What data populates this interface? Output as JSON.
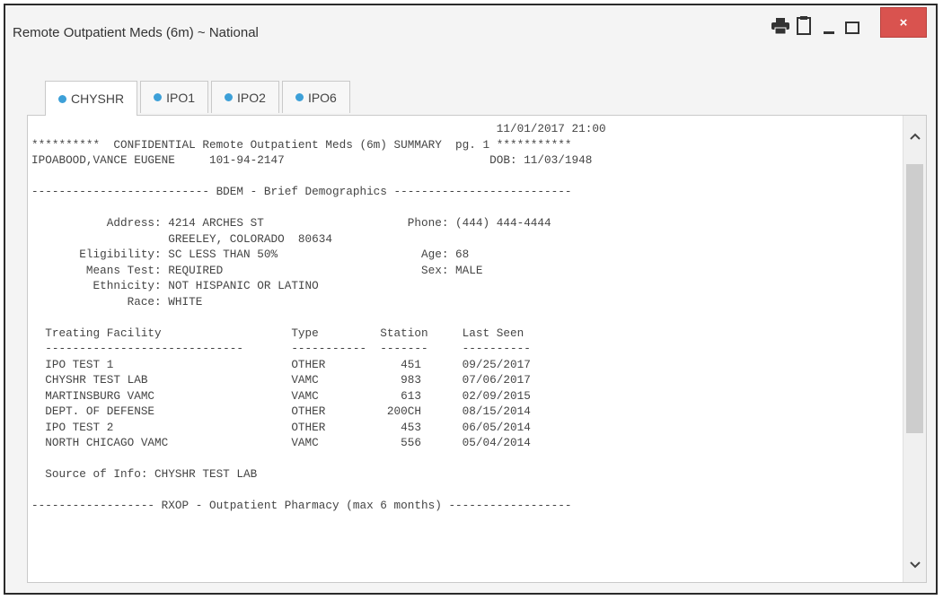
{
  "window": {
    "title": "Remote Outpatient Meds (6m) ~ National",
    "close_label": "×"
  },
  "icons": {
    "print": "print-icon",
    "clipboard": "clipboard-icon",
    "minimize": "minimize-icon",
    "maximize": "maximize-icon",
    "close": "close-icon",
    "scroll_up": "chevron-up-icon",
    "scroll_down": "chevron-down-icon"
  },
  "colors": {
    "tab_dot": "#3da0d8",
    "close_button": "#d9534f"
  },
  "tabs": [
    {
      "label": "CHYSHR",
      "active": true
    },
    {
      "label": "IPO1",
      "active": false
    },
    {
      "label": "IPO2",
      "active": false
    },
    {
      "label": "IPO6",
      "active": false
    }
  ],
  "report": {
    "lines": [
      "                                                                    11/01/2017 21:00",
      "**********  CONFIDENTIAL Remote Outpatient Meds (6m) SUMMARY  pg. 1 ***********",
      "IPOABOOD,VANCE EUGENE     101-94-2147                              DOB: 11/03/1948",
      "",
      "-------------------------- BDEM - Brief Demographics --------------------------",
      "",
      "           Address: 4214 ARCHES ST                     Phone: (444) 444-4444",
      "                    GREELEY, COLORADO  80634",
      "       Eligibility: SC LESS THAN 50%                     Age: 68",
      "        Means Test: REQUIRED                             Sex: MALE",
      "         Ethnicity: NOT HISPANIC OR LATINO",
      "              Race: WHITE",
      "",
      "  Treating Facility                   Type         Station     Last Seen",
      "  -----------------------------       -----------  -------     ----------",
      "  IPO TEST 1                          OTHER           451      09/25/2017",
      "  CHYSHR TEST LAB                     VAMC            983      07/06/2017",
      "  MARTINSBURG VAMC                    VAMC            613      02/09/2015",
      "  DEPT. OF DEFENSE                    OTHER         200CH      08/15/2014",
      "  IPO TEST 2                          OTHER           453      06/05/2014",
      "  NORTH CHICAGO VAMC                  VAMC            556      05/04/2014",
      "",
      "  Source of Info: CHYSHR TEST LAB",
      "",
      "------------------ RXOP - Outpatient Pharmacy (max 6 months) ------------------"
    ]
  }
}
